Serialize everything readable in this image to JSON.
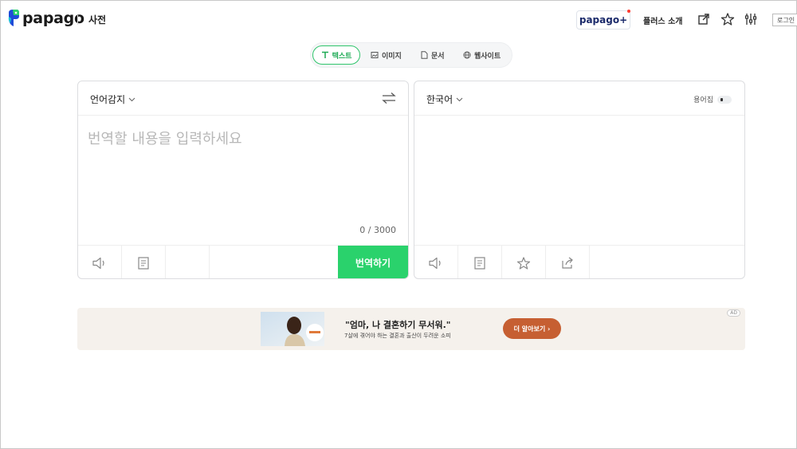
{
  "header": {
    "logo_text": "papago",
    "dictionary_link": "사전",
    "plus_badge": "papago+",
    "plus_intro": "플러스 소개",
    "login_label": "로그인"
  },
  "tabs": [
    {
      "label": "텍스트",
      "icon": "text-icon",
      "active": true
    },
    {
      "label": "이미지",
      "icon": "image-icon",
      "active": false
    },
    {
      "label": "문서",
      "icon": "document-icon",
      "active": false
    },
    {
      "label": "웹사이트",
      "icon": "globe-icon",
      "active": false
    }
  ],
  "source": {
    "language": "언어감지",
    "placeholder": "번역할 내용을 입력하세요",
    "value": "",
    "char_count": "0 / 3000",
    "translate_label": "번역하기"
  },
  "target": {
    "language": "한국어",
    "glossary_label": "용어집"
  },
  "ad": {
    "title": "\"엄마, 나 결혼하기 무서워.\"",
    "subtitle": "7살에 겪어야 하는 결혼과 출산이 두려운 소피",
    "cta": "더 알아보기 ›",
    "badge": "AD"
  },
  "colors": {
    "accent": "#2ad26c",
    "active_tab_text": "#1faa55",
    "ad_background": "#f5f1ec",
    "ad_cta": "#c65f32",
    "plus_dot": "#ff3b30"
  }
}
